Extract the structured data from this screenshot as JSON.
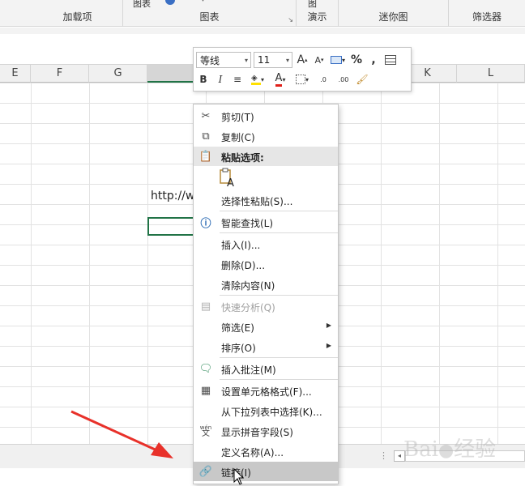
{
  "ribbon": {
    "groups": [
      {
        "label": "加载项"
      },
      {
        "label": "图表",
        "top": "图表"
      },
      {
        "label": "演示",
        "top": "图"
      },
      {
        "label": "迷你图"
      },
      {
        "label": "筛选器"
      }
    ]
  },
  "columns": [
    "E",
    "F",
    "G",
    "",
    "K",
    "L"
  ],
  "cell": {
    "text": "http://w"
  },
  "mini_toolbar": {
    "font_name": "等线",
    "font_size": "11",
    "grow_font": "A",
    "shrink_font": "A",
    "percent": "%",
    "comma": ",",
    "bold": "B",
    "italic": "I",
    "font_color": "A",
    "increase_decimal": ".0",
    "decrease_decimal": ".00"
  },
  "context_menu": {
    "items": [
      {
        "label": "剪切(T)",
        "icon": "scissors-icon"
      },
      {
        "label": "复制(C)",
        "icon": "copy-icon"
      },
      {
        "label": "粘贴选项:",
        "icon": "paste-icon"
      },
      {
        "label": "A",
        "icon": "paste-keep-text-icon"
      },
      {
        "label": "选择性粘贴(S)...",
        "icon": ""
      },
      {
        "label": "智能查找(L)",
        "icon": "smart-lookup-icon"
      },
      {
        "label": "插入(I)...",
        "icon": ""
      },
      {
        "label": "删除(D)...",
        "icon": ""
      },
      {
        "label": "清除内容(N)",
        "icon": ""
      },
      {
        "label": "快速分析(Q)",
        "icon": "quick-analysis-icon"
      },
      {
        "label": "筛选(E)",
        "icon": ""
      },
      {
        "label": "排序(O)",
        "icon": ""
      },
      {
        "label": "插入批注(M)",
        "icon": "comment-icon"
      },
      {
        "label": "设置单元格格式(F)...",
        "icon": "format-cells-icon"
      },
      {
        "label": "从下拉列表中选择(K)...",
        "icon": ""
      },
      {
        "label": "显示拼音字段(S)",
        "icon": "pinyin-icon"
      },
      {
        "label": "定义名称(A)...",
        "icon": ""
      },
      {
        "label": "链接(I)",
        "icon": "link-icon"
      }
    ],
    "pinyin_icon_text": "wén",
    "pinyin_icon_char": "文"
  },
  "watermark": "Bai 经验",
  "colors": {
    "accent": "#217346",
    "arrow": "#e8312a"
  }
}
